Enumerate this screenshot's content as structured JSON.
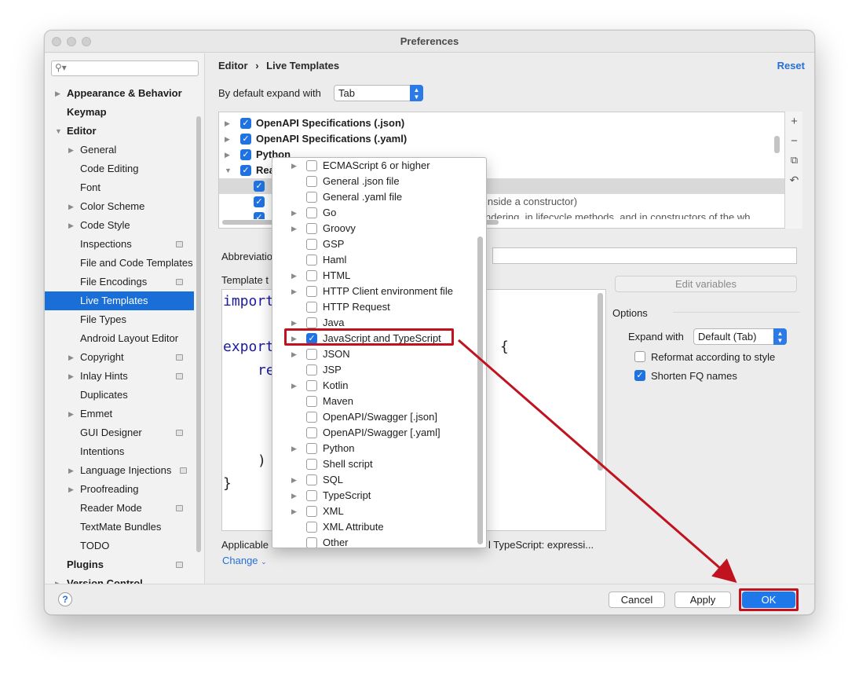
{
  "window": {
    "title": "Preferences"
  },
  "sidebar": {
    "search_placeholder": "",
    "items": [
      {
        "label": "Appearance & Behavior"
      },
      {
        "label": "Keymap"
      },
      {
        "label": "Editor"
      },
      {
        "label": "General"
      },
      {
        "label": "Code Editing"
      },
      {
        "label": "Font"
      },
      {
        "label": "Color Scheme"
      },
      {
        "label": "Code Style"
      },
      {
        "label": "Inspections"
      },
      {
        "label": "File and Code Templates"
      },
      {
        "label": "File Encodings"
      },
      {
        "label": "Live Templates"
      },
      {
        "label": "File Types"
      },
      {
        "label": "Android Layout Editor"
      },
      {
        "label": "Copyright"
      },
      {
        "label": "Inlay Hints"
      },
      {
        "label": "Duplicates"
      },
      {
        "label": "Emmet"
      },
      {
        "label": "GUI Designer"
      },
      {
        "label": "Intentions"
      },
      {
        "label": "Language Injections"
      },
      {
        "label": "Proofreading"
      },
      {
        "label": "Reader Mode"
      },
      {
        "label": "TextMate Bundles"
      },
      {
        "label": "TODO"
      },
      {
        "label": "Plugins"
      },
      {
        "label": "Version Control"
      }
    ]
  },
  "header": {
    "crumb_parent": "Editor",
    "crumb_sep": "›",
    "crumb_current": "Live Templates",
    "reset_label": "Reset"
  },
  "expand": {
    "label": "By default expand with",
    "value": "Tab"
  },
  "templates": {
    "rows": [
      {
        "label": "OpenAPI Specifications (.json)"
      },
      {
        "label": "OpenAPI Specifications (.yaml)"
      },
      {
        "label": "Python"
      },
      {
        "label": "Rea"
      },
      {
        "label": ""
      },
      {
        "label": "inside a constructor)"
      },
      {
        "label": "ndering, in lifecycle methods, and in constructors of the wh"
      }
    ]
  },
  "details": {
    "abbreviation_label": "Abbreviatio",
    "template_label": "Template t",
    "applicable_label": "Applicable",
    "applicable_tail": "l TypeScript: expressi...",
    "change_label": "Change",
    "edit_variables_label": "Edit variables",
    "options_title": "Options",
    "expand_with_label": "Expand with",
    "expand_with_value": "Default (Tab)",
    "reformat_label": "Reformat according to style",
    "shorten_label": "Shorten FQ names"
  },
  "code_lines": [
    "import",
    "export",
    "re",
    ")",
    "}",
    "{"
  ],
  "popup": {
    "items": [
      {
        "label": "ECMAScript 6 or higher",
        "has_children": true,
        "checked": false
      },
      {
        "label": "General .json file",
        "has_children": false,
        "checked": false
      },
      {
        "label": "General .yaml file",
        "has_children": false,
        "checked": false
      },
      {
        "label": "Go",
        "has_children": true,
        "checked": false
      },
      {
        "label": "Groovy",
        "has_children": true,
        "checked": false
      },
      {
        "label": "GSP",
        "has_children": false,
        "checked": false
      },
      {
        "label": "Haml",
        "has_children": false,
        "checked": false
      },
      {
        "label": "HTML",
        "has_children": true,
        "checked": false
      },
      {
        "label": "HTTP Client environment file",
        "has_children": true,
        "checked": false
      },
      {
        "label": "HTTP Request",
        "has_children": false,
        "checked": false
      },
      {
        "label": "Java",
        "has_children": true,
        "checked": false
      },
      {
        "label": "JavaScript and TypeScript",
        "has_children": true,
        "checked": true
      },
      {
        "label": "JSON",
        "has_children": true,
        "checked": false
      },
      {
        "label": "JSP",
        "has_children": false,
        "checked": false
      },
      {
        "label": "Kotlin",
        "has_children": true,
        "checked": false
      },
      {
        "label": "Maven",
        "has_children": false,
        "checked": false
      },
      {
        "label": "OpenAPI/Swagger [.json]",
        "has_children": false,
        "checked": false
      },
      {
        "label": "OpenAPI/Swagger [.yaml]",
        "has_children": false,
        "checked": false
      },
      {
        "label": "Python",
        "has_children": true,
        "checked": false
      },
      {
        "label": "Shell script",
        "has_children": false,
        "checked": false
      },
      {
        "label": "SQL",
        "has_children": true,
        "checked": false
      },
      {
        "label": "TypeScript",
        "has_children": true,
        "checked": false
      },
      {
        "label": "XML",
        "has_children": true,
        "checked": false
      },
      {
        "label": "XML Attribute",
        "has_children": false,
        "checked": false
      },
      {
        "label": "Other",
        "has_children": false,
        "checked": false
      }
    ]
  },
  "buttons": {
    "help": "?",
    "cancel": "Cancel",
    "apply": "Apply",
    "ok": "OK"
  },
  "colors": {
    "accent": "#1f78ea",
    "highlight": "#c1121f",
    "selection": "#1a6ed8"
  }
}
